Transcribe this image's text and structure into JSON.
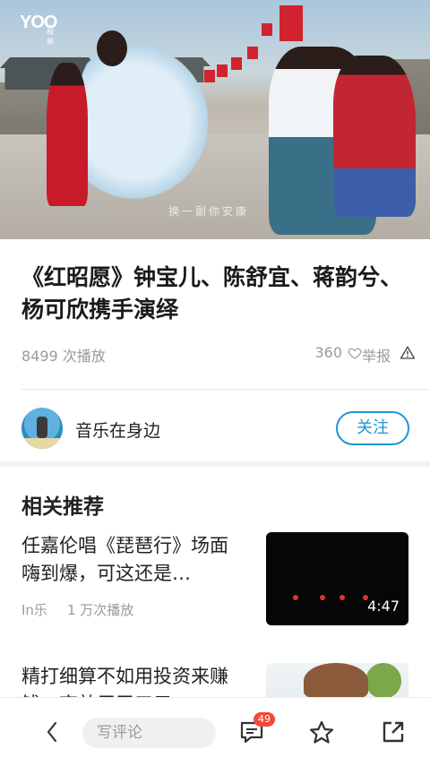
{
  "video": {
    "logo": "YOO",
    "logo_sub": "视频",
    "subtitle": "换一副你安康"
  },
  "title": "《红昭愿》钟宝儿、陈舒宜、蒋韵兮、杨可欣携手演绎",
  "stats": {
    "plays": "8499 次播放",
    "likes": "360",
    "report": "举报"
  },
  "author": {
    "name": "音乐在身边",
    "follow_label": "关注"
  },
  "related": {
    "heading": "相关推荐",
    "items": [
      {
        "title": "任嘉伦唱《琵琶行》场面嗨到爆，可这还是…",
        "source": "In乐",
        "plays": "1 万次播放",
        "duration": "4:47"
      },
      {
        "title": "精打细算不如用投资来赚钱，高效用于三元",
        "source": "",
        "plays": "",
        "duration": ""
      }
    ]
  },
  "bottom": {
    "comment_placeholder": "写评论",
    "comment_count": "49"
  },
  "colors": {
    "accent": "#1e95d4",
    "badge": "#f04a3a",
    "muted": "#9a9a9a"
  }
}
